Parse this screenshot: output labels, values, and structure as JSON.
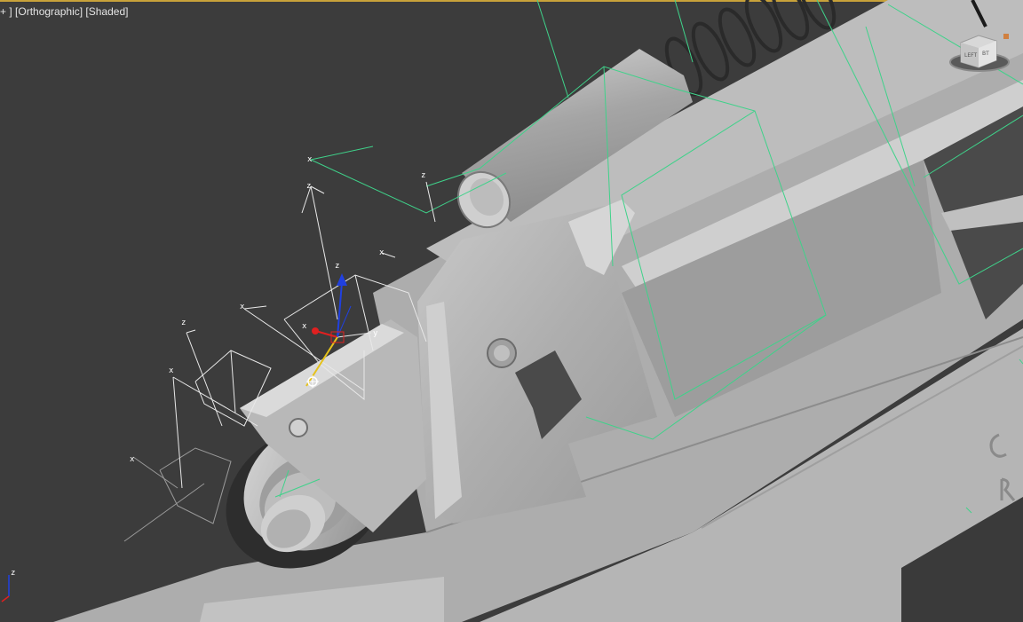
{
  "viewport": {
    "label_plus": "+",
    "label_view": "[Orthographic]",
    "label_shading": "[Shaded]"
  },
  "viewcube": {
    "face_front": "LEFT",
    "face_side": "BT"
  },
  "gizmo": {
    "x_label": "x",
    "y_label": "y",
    "z_label": "z"
  },
  "axis_tripod": {
    "z_label": "z"
  },
  "helpers": [
    {
      "label": "x"
    },
    {
      "label": "z"
    },
    {
      "label": "z"
    },
    {
      "label": "x"
    },
    {
      "label": "x"
    },
    {
      "label": "z"
    },
    {
      "label": "x"
    },
    {
      "label": "x"
    }
  ],
  "colors": {
    "background": "#3c3c3c",
    "model": "#a9a9a9",
    "wire_green": "#3fd28a",
    "wire_white": "#e8e8e8",
    "axis_x": "#e02020",
    "axis_y": "#20c020",
    "axis_z": "#2040e0",
    "active_border": "#c8a23a"
  }
}
